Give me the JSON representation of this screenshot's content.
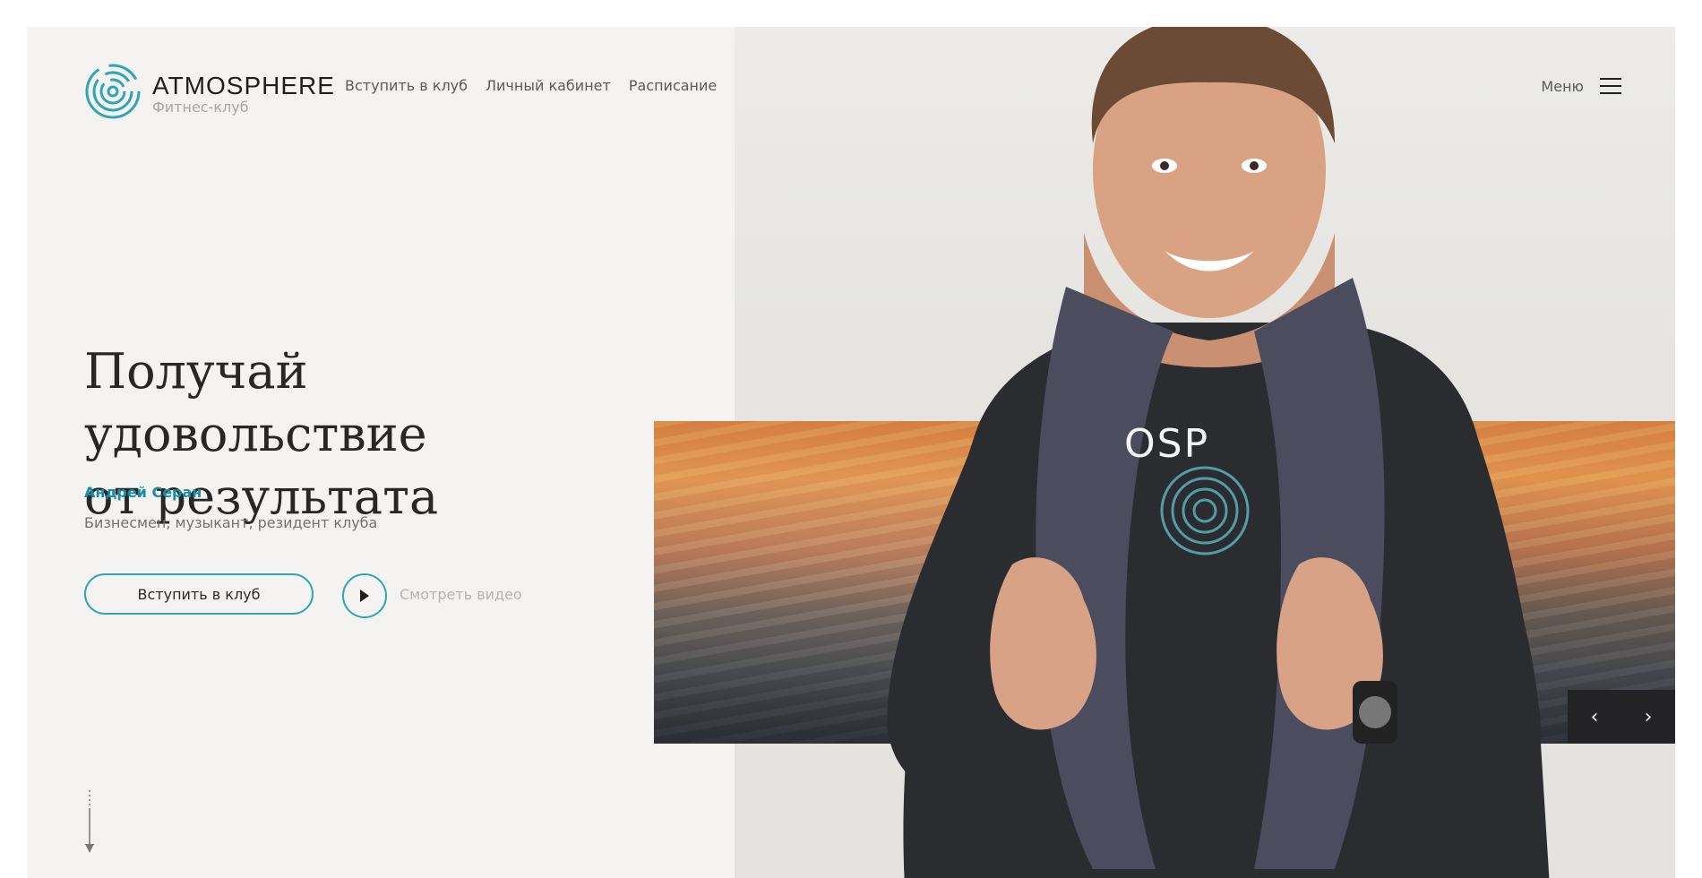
{
  "brand": {
    "name": "ATMOSPHERE",
    "subtitle": "Фитнес-клуб",
    "accent_color": "#2fa5b8"
  },
  "nav": {
    "items": [
      {
        "label": "Вступить в клуб"
      },
      {
        "label": "Личный кабинет"
      },
      {
        "label": "Расписание"
      }
    ]
  },
  "menu": {
    "label": "Меню",
    "icon": "hamburger-icon"
  },
  "hero": {
    "title_line1": "Получай удовольствие",
    "title_line2": "от результата",
    "person_name": "Андрей Серан",
    "person_desc": "Бизнесмен, музыкант, резидент клуба",
    "join_button": "Вступить в клуб",
    "video_label": "Смотреть видео",
    "play_icon": "play-icon"
  },
  "slider": {
    "prev_icon": "chevron-left-icon",
    "next_icon": "chevron-right-icon",
    "prev_glyph": "‹",
    "next_glyph": "›"
  },
  "shirt_text": "OSP"
}
